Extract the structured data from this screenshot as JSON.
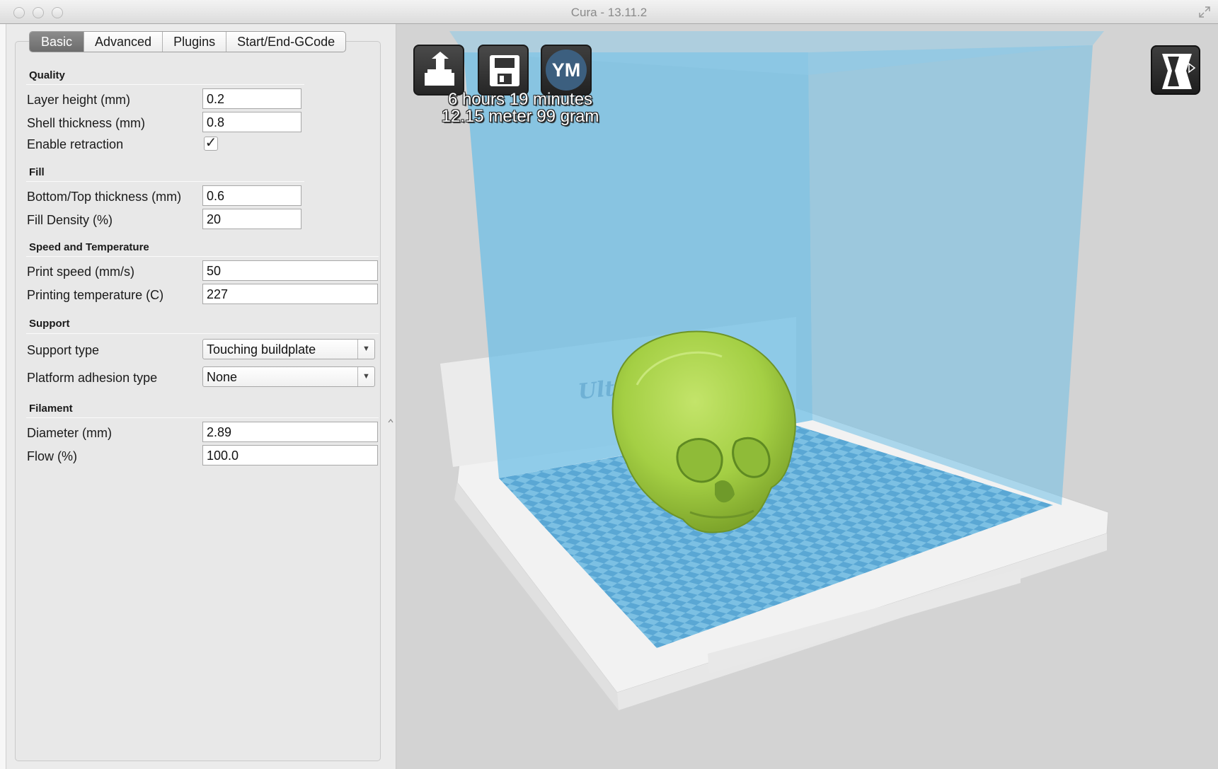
{
  "window": {
    "title": "Cura - 13.11.2"
  },
  "tabs": [
    {
      "label": "Basic"
    },
    {
      "label": "Advanced"
    },
    {
      "label": "Plugins"
    },
    {
      "label": "Start/End-GCode"
    }
  ],
  "quality": {
    "title": "Quality",
    "layer_height_label": "Layer height (mm)",
    "layer_height": "0.2",
    "shell_thickness_label": "Shell thickness (mm)",
    "shell_thickness": "0.8",
    "retraction_label": "Enable retraction",
    "retraction_checked": "✓"
  },
  "fill": {
    "title": "Fill",
    "bottom_top_label": "Bottom/Top thickness (mm)",
    "bottom_top": "0.6",
    "density_label": "Fill Density (%)",
    "density": "20"
  },
  "speed": {
    "title": "Speed and Temperature",
    "print_speed_label": "Print speed (mm/s)",
    "print_speed": "50",
    "temperature_label": "Printing temperature (C)",
    "temperature": "227"
  },
  "support": {
    "title": "Support",
    "type_label": "Support type",
    "type_value": "Touching buildplate",
    "adhesion_label": "Platform adhesion type",
    "adhesion_value": "None"
  },
  "filament": {
    "title": "Filament",
    "diameter_label": "Diameter (mm)",
    "diameter": "2.89",
    "flow_label": "Flow (%)",
    "flow": "100.0"
  },
  "viewport": {
    "print_time": "6 hours 19 minutes",
    "print_material": "12.15 meter 99 gram",
    "youmagine_label": "YM",
    "platform_brand": "Ultimaker",
    "colors": {
      "model": "#a6d14c",
      "build_volume": "#6fbfe6",
      "platform": "#efefef"
    }
  }
}
